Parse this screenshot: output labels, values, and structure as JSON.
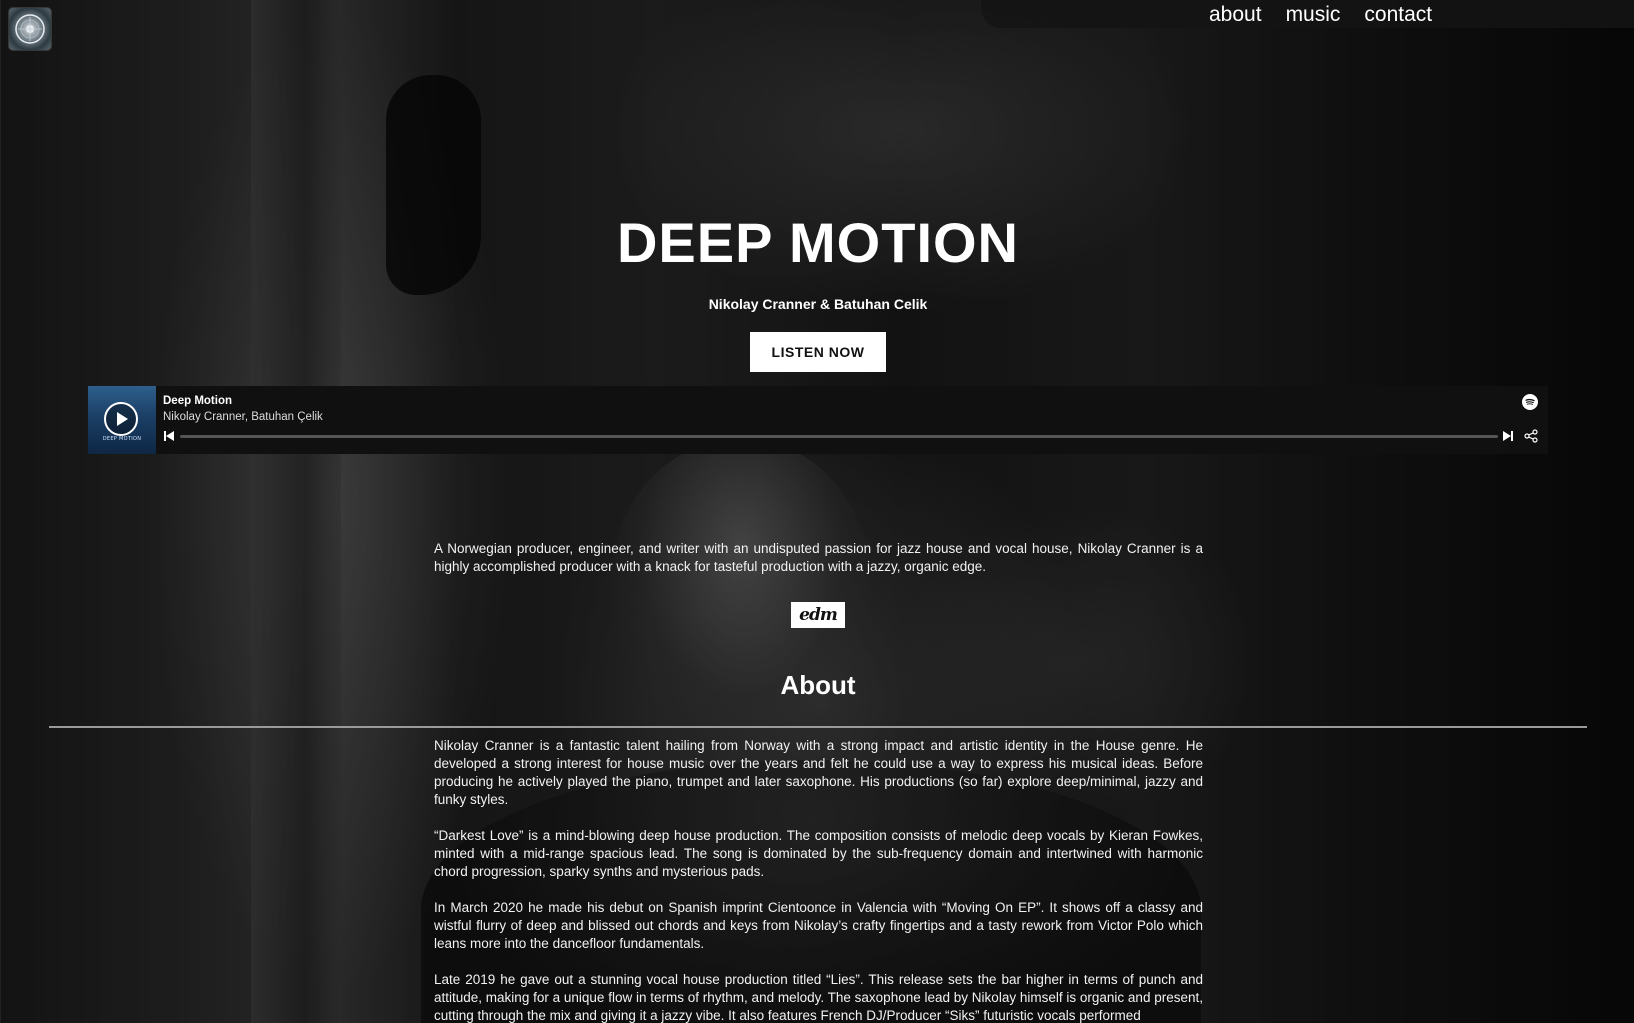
{
  "nav": {
    "logo_icon": "circular-emblem-icon",
    "links": [
      "about",
      "music",
      "contact"
    ]
  },
  "hero": {
    "title": "DEEP MOTION",
    "subtitle": "Nikolay Cranner & Batuhan Celik",
    "listen_label": "LISTEN NOW"
  },
  "player": {
    "track_title": "Deep Motion",
    "artists": "Nikolay Cranner, Batuhan Çelik",
    "cover_text": "DEEP MOTION",
    "brand_icon": "spotify-icon",
    "progress": 0.0
  },
  "intro": {
    "text": "A Norwegian producer, engineer, and writer with an undisputed passion for jazz house and vocal house, Nikolay Cranner is a highly accomplished producer with a knack for tasteful production with a jazzy, organic edge.",
    "press_logo": "edm"
  },
  "about": {
    "heading": "About",
    "paragraphs": [
      "Nikolay Cranner is a fantastic talent hailing from Norway with a strong impact and artistic identity in the House genre. He developed a strong interest for house music over the years and felt he could use a way to express his musical ideas. Before producing he actively played the piano, trumpet and later saxophone. His productions (so far) explore deep/minimal, jazzy and funky styles.",
      "“Darkest Love” is a mind-blowing deep house production. The composition consists of melodic deep vocals by Kieran Fowkes, minted with a mid-range spacious lead. The song is dominated by the sub-frequency domain and intertwined with harmonic chord progression, sparky synths and mysterious pads.",
      "In March 2020 he made his debut on Spanish imprint Cientoonce in Valencia with “Moving On EP”. It shows off a classy and wistful flurry of deep and blissed out chords and keys from Nikolay’s crafty fingertips and a tasty rework from Victor Polo which leans more into the dancefloor fundamentals.",
      "Late 2019 he gave out a stunning vocal house production titled “Lies”. This release sets the bar higher in terms of punch and attitude, making for a unique flow in terms of rhythm, and melody. The saxophone lead by Nikolay himself is organic and present, cutting through the mix and giving it a jazzy vibe. It also features French DJ/Producer “Siks” futuristic vocals performed"
    ]
  },
  "colors": {
    "background": "#0b0b0b",
    "player_bg": "#101010",
    "button_bg": "#ffffff",
    "divider": "#9a9a9a"
  }
}
